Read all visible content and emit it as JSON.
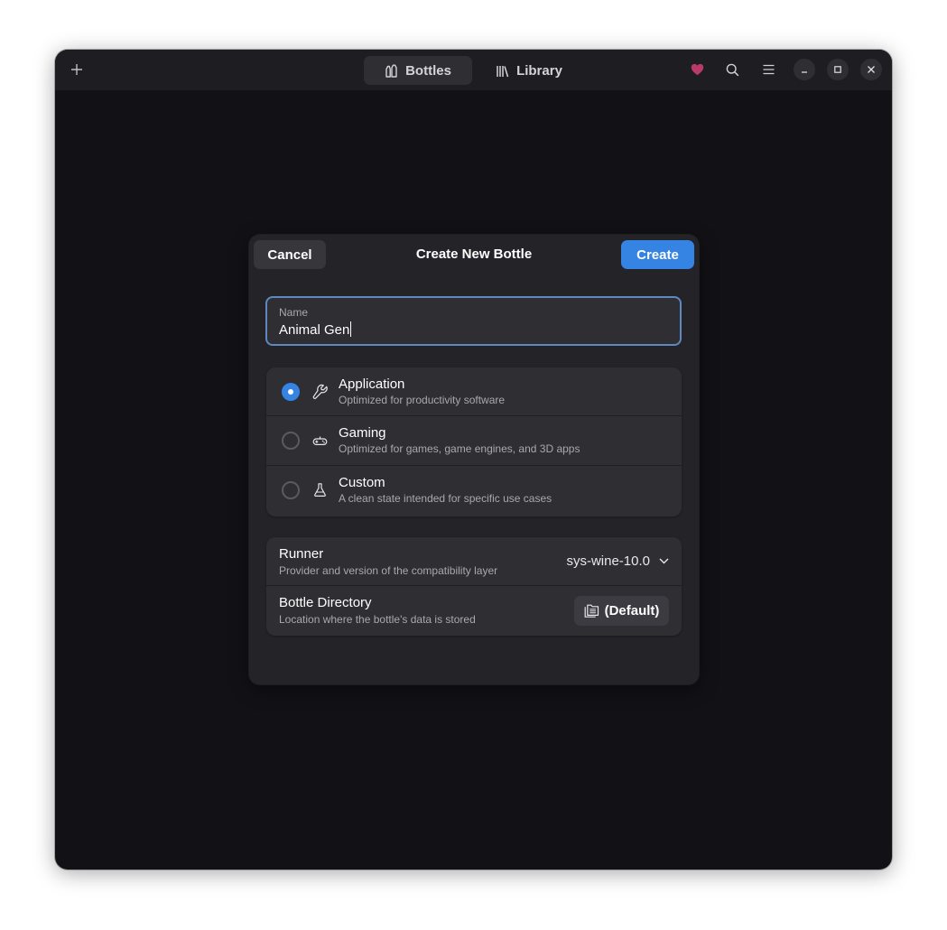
{
  "headerbar": {
    "add_icon": "plus-icon",
    "tabs": [
      {
        "label": "Bottles",
        "icon": "bottles-icon",
        "active": true
      },
      {
        "label": "Library",
        "icon": "library-icon",
        "active": false
      }
    ],
    "actions": [
      "heart-icon",
      "search-icon",
      "menu-icon"
    ],
    "window_controls": [
      "minimize-icon",
      "maximize-icon",
      "close-icon"
    ],
    "heart_color": "#b83a6a"
  },
  "dialog": {
    "title": "Create New Bottle",
    "cancel_label": "Cancel",
    "create_label": "Create",
    "accent_color": "#3584e4",
    "name_field": {
      "label": "Name",
      "value": "Animal Gen"
    },
    "environments": [
      {
        "title": "Application",
        "subtitle": "Optimized for productivity software",
        "icon": "wrench-icon",
        "selected": true
      },
      {
        "title": "Gaming",
        "subtitle": "Optimized for games, game engines, and 3D apps",
        "icon": "gamepad-icon",
        "selected": false
      },
      {
        "title": "Custom",
        "subtitle": "A clean state intended for specific use cases",
        "icon": "flask-icon",
        "selected": false
      }
    ],
    "runner": {
      "title": "Runner",
      "subtitle": "Provider and version of the compatibility layer",
      "value": "sys-wine-10.0"
    },
    "directory": {
      "title": "Bottle Directory",
      "subtitle": "Location where the bottle's data is stored",
      "button_label": "(Default)",
      "icon": "folder-copy-icon"
    }
  }
}
